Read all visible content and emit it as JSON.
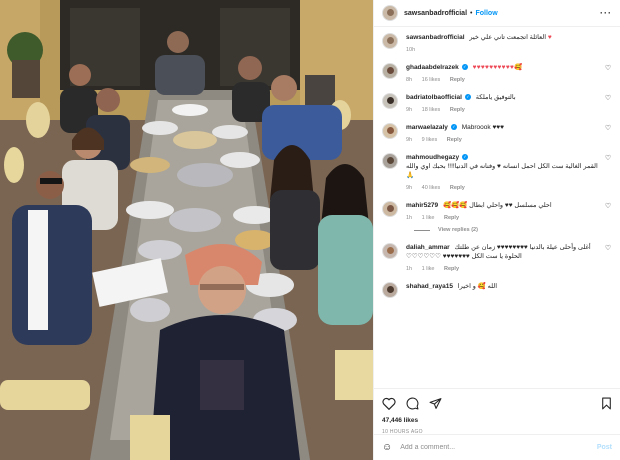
{
  "post": {
    "author": "sawsanbadrofficial",
    "follow_label": "Follow",
    "more_icon": "more-icon"
  },
  "caption": {
    "author": "sawsanbadrofficial",
    "text": "العائلة اتجمعت تاني علي خير",
    "emoji": "♥",
    "time": "10h"
  },
  "comments": [
    {
      "user": "ghadaabdelrazek",
      "verified": true,
      "text": "♥♥♥♥♥♥♥♥♥♥🥰",
      "time": "8h",
      "likes": "16 likes",
      "reply": "Reply"
    },
    {
      "user": "badriatolbaofficial",
      "verified": true,
      "text": "بالتوفيق ياملكة",
      "time": "9h",
      "likes": "18 likes",
      "reply": "Reply"
    },
    {
      "user": "marwaelazaly",
      "verified": true,
      "text": "Mabroook ♥♥♥",
      "time": "9h",
      "likes": "9 likes",
      "reply": "Reply"
    },
    {
      "user": "mahmoudhegazy",
      "verified": true,
      "text": "القمر الغالية ست الكل احمل انسانه ♥ وفنانه في الدنيا!!!! بحبك اوي والله 🙏",
      "time": "9h",
      "likes": "40 likes",
      "reply": "Reply"
    },
    {
      "user": "mahir5279",
      "verified": false,
      "text": "احلي مسلسل ♥♥ واحلي ابطال 🥰🥰🥰",
      "time": "1h",
      "likes": "1 like",
      "reply": "Reply"
    },
    {
      "user": "daliah_ammar",
      "verified": false,
      "text": "أغلى وأحلى عيلة بالدنيا ♥♥♥♥♥♥♥♥ زمان عن طلتك الحلوة يا ست الكل ♥♥♥♥♥♥♥ ♡♡♡♡♡♡",
      "time": "1h",
      "likes": "1 like",
      "reply": "Reply"
    },
    {
      "user": "shahad_raya15",
      "verified": false,
      "text": "الله 🥰 و اخيرا",
      "time": "",
      "likes": "",
      "reply": ""
    }
  ],
  "view_replies_label": "View replies (2)",
  "actions": {
    "likes": "47,446 likes",
    "date": "10 hours ago"
  },
  "add_comment": {
    "placeholder": "Add a comment...",
    "post_label": "Post"
  }
}
